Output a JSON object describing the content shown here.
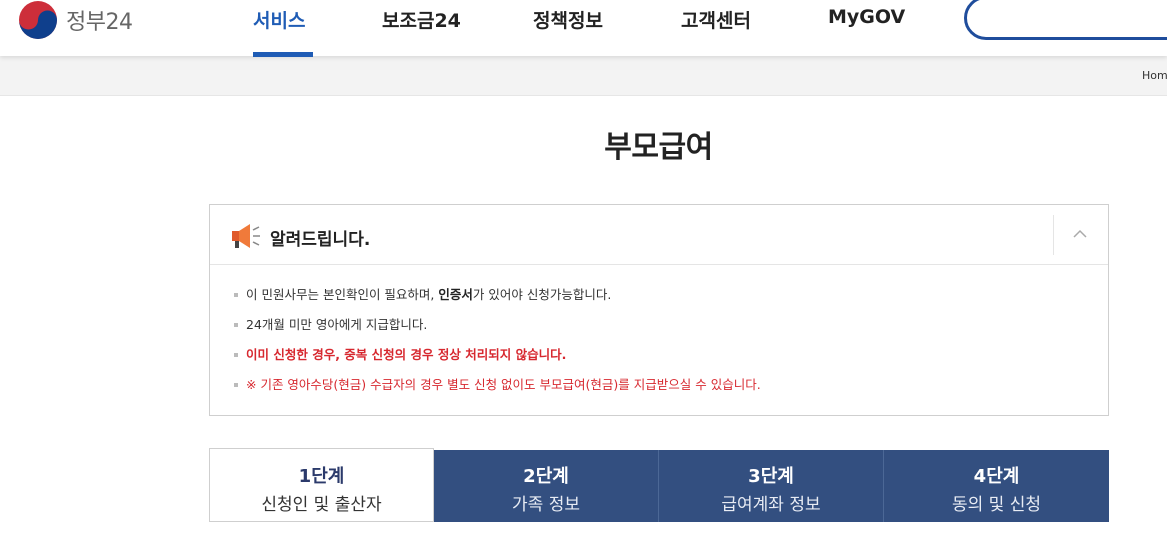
{
  "header": {
    "logo_text": "정부24",
    "nav": [
      {
        "label": "서비스",
        "active": true
      },
      {
        "label": "보조금24",
        "active": false
      },
      {
        "label": "정책정보",
        "active": false
      },
      {
        "label": "고객센터",
        "active": false
      },
      {
        "label": "MyGOV",
        "active": false
      }
    ]
  },
  "breadcrumb": {
    "home": "Hom"
  },
  "page": {
    "title": "부모급여"
  },
  "notice": {
    "title": "알려드립니다.",
    "items": {
      "0": {
        "before": "이 민원사무는 본인확인이 필요하며, ",
        "bold": "인증서",
        "after": "가 있어야 신청가능합니다."
      },
      "1": {
        "text": "24개월 미만 영아에게 지급합니다."
      },
      "2": {
        "text": "이미 신청한 경우, 중복 신청의 경우 정상 처리되지 않습니다."
      },
      "3": {
        "text": "※ 기존 영아수당(현금) 수급자의 경우 별도 신청 없이도 부모급여(현금)를 지급받으실 수 있습니다."
      }
    }
  },
  "steps": [
    {
      "num": "1단계",
      "label": "신청인 및 출산자",
      "active": true
    },
    {
      "num": "2단계",
      "label": "가족 정보",
      "active": false
    },
    {
      "num": "3단계",
      "label": "급여계좌 정보",
      "active": false
    },
    {
      "num": "4단계",
      "label": "동의 및 신청",
      "active": false
    }
  ],
  "colors": {
    "brand_blue": "#1f5cb5",
    "step_bg": "#334f80",
    "alert_red": "#d7282f"
  }
}
